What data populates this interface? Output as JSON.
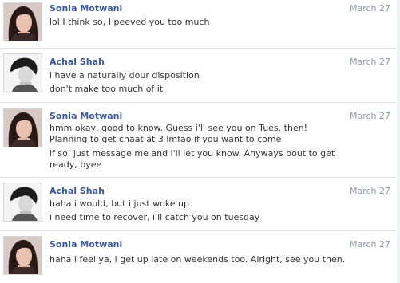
{
  "messages": [
    {
      "sender": "Sonia Motwani",
      "date": "March 27",
      "avatar_icon": "female-profile-photo",
      "lines": [
        "lol I think so, I peeved you too much"
      ]
    },
    {
      "sender": "Achal Shah",
      "date": "March 27",
      "avatar_icon": "male-profile-photo",
      "lines": [
        "i have a naturally dour disposition",
        "don't make too much of it"
      ]
    },
    {
      "sender": "Sonia Motwani",
      "date": "March 27",
      "avatar_icon": "female-profile-photo",
      "lines": [
        "hmm okay, good to know. Guess i'll see you on Tues. then! Planning to get chaat at 3 lmfao if you want to come",
        "if so, just message me and i'll let you know. Anyways bout to get ready, byee"
      ]
    },
    {
      "sender": "Achal Shah",
      "date": "March 27",
      "avatar_icon": "male-profile-photo",
      "lines": [
        "haha i would, but i just woke up",
        "i need time to recover, i'll catch you on tuesday"
      ]
    },
    {
      "sender": "Sonia Motwani",
      "date": "March 27",
      "avatar_icon": "female-profile-photo",
      "lines": [
        "haha i feel ya, i get up late on weekends too. Alright, see you then."
      ]
    }
  ],
  "colors": {
    "name_link": "#3b5998",
    "date_text": "#8f9aae",
    "body_text": "#333333",
    "divider": "#e0e4ea"
  }
}
